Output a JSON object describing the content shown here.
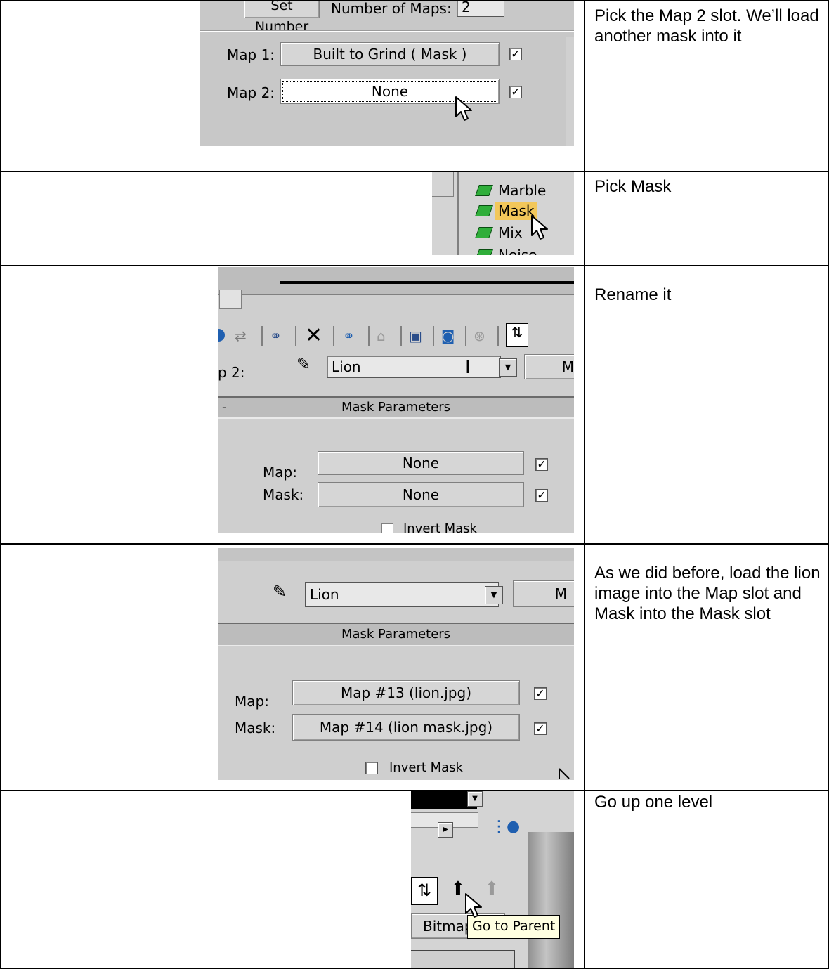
{
  "rows": [
    {
      "note": "Pick the  Map 2 slot. We’ll load another mask into it",
      "shot": {
        "set_number_label": "Set Number",
        "number_of_maps_label": "Number of Maps:",
        "number_of_maps_value": "2",
        "map1_label": "Map 1:",
        "map1_button": "Built to Grind  ( Mask )",
        "map1_checked": "✓",
        "map2_label": "Map 2:",
        "map2_button": "None",
        "map2_checked": "✓"
      }
    },
    {
      "note": "Pick Mask",
      "shot": {
        "items": [
          "Marble",
          "Mask",
          "Mix",
          "Noise"
        ],
        "selected": "Mask"
      }
    },
    {
      "note": "Rename it",
      "shot": {
        "map_level_label": "p 2:",
        "name_value": "Lion",
        "type_button": "M",
        "rollout_title": "Mask Parameters",
        "map_label": "Map:",
        "map_button": "None",
        "mask_label": "Mask:",
        "mask_button": "None",
        "check": "✓",
        "invert_label": "Invert Mask"
      }
    },
    {
      "note": "As we did before, load the lion image into the Map slot and Mask into the Mask slot",
      "shot": {
        "name_value": "Lion",
        "type_button": "M",
        "rollout_title": "Mask Parameters",
        "map_label": "Map:",
        "map_button": "Map #13 (lion.jpg)",
        "mask_label": "Mask:",
        "mask_button": "Map #14 (lion mask.jpg)",
        "check": "✓",
        "invert_label": "Invert Mask"
      }
    },
    {
      "note": "Go up one level",
      "shot": {
        "bitmap_button": "Bitmap",
        "tooltip": "Go to Parent"
      }
    }
  ]
}
